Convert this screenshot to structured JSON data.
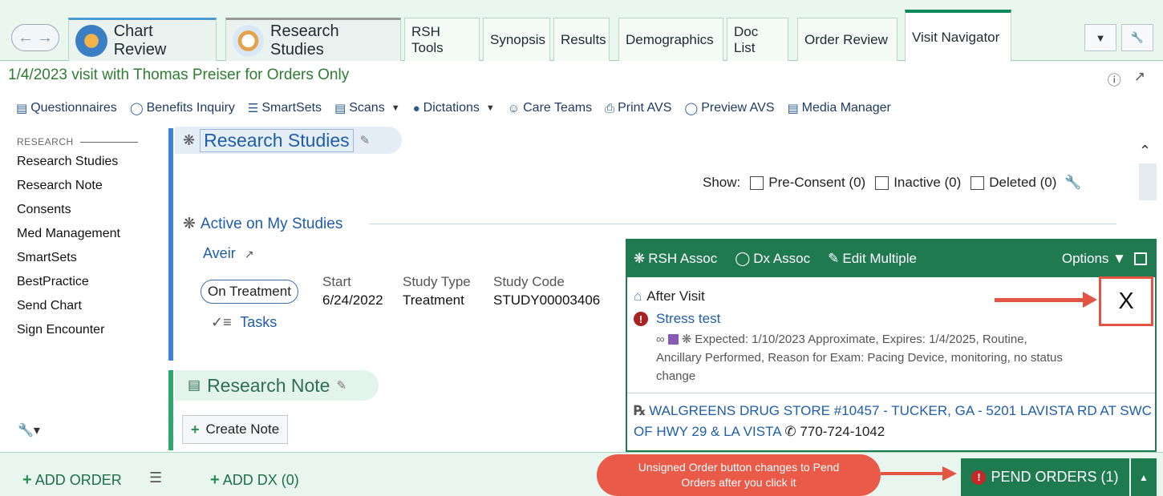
{
  "tabs": [
    {
      "label": "Chart Review"
    },
    {
      "label": "Research Studies"
    },
    {
      "label": "RSH Tools"
    },
    {
      "label": "Synopsis"
    },
    {
      "label": "Results"
    },
    {
      "label": "Demographics"
    },
    {
      "label": "Doc List"
    },
    {
      "label": "Order Review"
    },
    {
      "label": "Visit Navigator"
    }
  ],
  "header": {
    "visit_title": "1/4/2023 visit with Thomas Preiser for Orders Only"
  },
  "toolbar": [
    {
      "label": "Questionnaires",
      "icon": "questionnaire-icon"
    },
    {
      "label": "Benefits Inquiry",
      "icon": "benefits-icon"
    },
    {
      "label": "SmartSets",
      "icon": "smartsets-icon"
    },
    {
      "label": "Scans",
      "icon": "scans-icon"
    },
    {
      "label": "Dictations",
      "icon": "microphone-icon"
    },
    {
      "label": "Care Teams",
      "icon": "care-teams-icon"
    },
    {
      "label": "Print AVS",
      "icon": "printer-icon"
    },
    {
      "label": "Preview AVS",
      "icon": "preview-icon"
    },
    {
      "label": "Media Manager",
      "icon": "media-icon"
    }
  ],
  "sidebar": {
    "header": "RESEARCH",
    "items": [
      {
        "label": "Research Studies"
      },
      {
        "label": "Research Note"
      },
      {
        "label": "Consents"
      },
      {
        "label": "Med Management"
      },
      {
        "label": "SmartSets"
      },
      {
        "label": "BestPractice"
      },
      {
        "label": "Send Chart"
      },
      {
        "label": "Sign Encounter"
      }
    ]
  },
  "research": {
    "section_title": "Research Studies",
    "show_label": "Show:",
    "filters": [
      {
        "label": "Pre-Consent (0)"
      },
      {
        "label": "Inactive (0)"
      },
      {
        "label": "Deleted (0)"
      }
    ],
    "active_header": "Active on My Studies",
    "study_name": "Aveir",
    "status": "On Treatment",
    "columns": [
      {
        "header": "Start",
        "value": "6/24/2022"
      },
      {
        "header": "Study Type",
        "value": "Treatment"
      },
      {
        "header": "Study Code",
        "value": "STUDY00003406"
      }
    ],
    "tasks_label": "Tasks"
  },
  "note": {
    "section_title": "Research Note",
    "create_label": "Create Note"
  },
  "popup": {
    "actions": [
      {
        "label": "RSH Assoc"
      },
      {
        "label": "Dx Assoc"
      },
      {
        "label": "Edit Multiple"
      }
    ],
    "options_label": "Options",
    "group_label": "After Visit",
    "order_name": "Stress test",
    "order_details": "Expected: 1/10/2023 Approximate, Expires: 1/4/2025, Routine, Ancillary Performed, Reason for Exam: Pacing Device, monitoring, no status change",
    "pharmacy": "WALGREENS DRUG STORE #10457 - TUCKER, GA - 5201 LAVISTA RD AT SWC OF HWY 29 & LA VISTA",
    "phone": "770-724-1042"
  },
  "annotation": {
    "close_label": "X",
    "callout": "Unsigned Order button changes to Pend Orders after you click it"
  },
  "bottom": {
    "add_order": "ADD ORDER",
    "add_dx": "ADD DX (0)",
    "pend_orders": "PEND ORDERS (1)"
  },
  "colors": {
    "accent_green": "#1f7a50",
    "link_blue": "#1f5da9",
    "annotation_red": "#e35442"
  }
}
